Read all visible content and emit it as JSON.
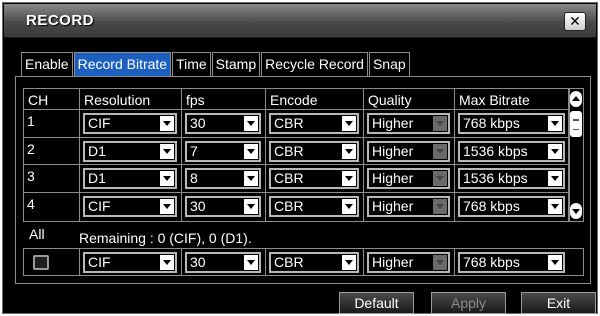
{
  "window": {
    "title": "RECORD",
    "close_label": "✕"
  },
  "tabs": [
    {
      "label": "Enable",
      "active": false
    },
    {
      "label": "Record Bitrate",
      "active": true
    },
    {
      "label": "Time",
      "active": false
    },
    {
      "label": "Stamp",
      "active": false
    },
    {
      "label": "Recycle Record",
      "active": false
    },
    {
      "label": "Snap",
      "active": false
    }
  ],
  "table": {
    "headers": [
      "CH",
      "Resolution",
      "fps",
      "Encode",
      "Quality",
      "Max Bitrate"
    ],
    "rows": [
      {
        "ch": "1",
        "resolution": "CIF",
        "fps": "30",
        "encode": "CBR",
        "quality": "Higher",
        "max_bitrate": "768 kbps"
      },
      {
        "ch": "2",
        "resolution": "D1",
        "fps": "7",
        "encode": "CBR",
        "quality": "Higher",
        "max_bitrate": "1536 kbps"
      },
      {
        "ch": "3",
        "resolution": "D1",
        "fps": "8",
        "encode": "CBR",
        "quality": "Higher",
        "max_bitrate": "1536 kbps"
      },
      {
        "ch": "4",
        "resolution": "CIF",
        "fps": "30",
        "encode": "CBR",
        "quality": "Higher",
        "max_bitrate": "768 kbps"
      }
    ]
  },
  "all": {
    "label": "All",
    "remaining": "Remaining : 0 (CIF), 0 (D1).",
    "resolution": "CIF",
    "fps": "30",
    "encode": "CBR",
    "quality": "Higher",
    "max_bitrate": "768 kbps"
  },
  "buttons": {
    "default": "Default",
    "apply": "Apply",
    "exit": "Exit"
  },
  "colors": {
    "active_tab": "#1d5fbf",
    "background": "#000000",
    "border": "#8c8c8c"
  }
}
